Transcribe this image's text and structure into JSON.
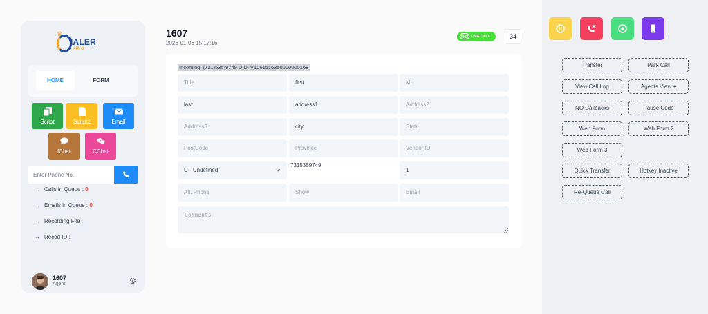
{
  "logo": {
    "text_main": "IALER",
    "text_sub": "KING"
  },
  "nav": {
    "home": "HOME",
    "form": "FORM"
  },
  "tools": [
    {
      "label": "Script",
      "color": "#2ea84a",
      "icon": "copy-icon"
    },
    {
      "label": "Script2",
      "color": "#fbbf24",
      "icon": "document-icon"
    },
    {
      "label": "Email",
      "color": "#1d8cf8",
      "icon": "envelope-icon"
    },
    {
      "label": "IChat",
      "color": "#b7773b",
      "icon": "chat-bubble-icon"
    },
    {
      "label": "CChat",
      "color": "#ec4899",
      "icon": "chat-bubbles-icon"
    }
  ],
  "phone": {
    "placeholder": "Enter Phone No.",
    "icon": "phone-icon"
  },
  "info": {
    "calls_label": "Calls in Queue : ",
    "calls_value": "0",
    "emails_label": "Emails in Queue : ",
    "emails_value": "0",
    "recording_label": "Recording File :",
    "record_label": "Recod ID :"
  },
  "agent": {
    "name": "1607",
    "role": "Agent"
  },
  "header": {
    "extension": "1607",
    "datetime": "2026-01-06 15:17:16",
    "live_short": "(((•)))",
    "live_label": "LIVE CALL",
    "counter": "34"
  },
  "incoming": "Incoming: (731)535-9749 UID: V1061516350000000168",
  "form": {
    "title": {
      "placeholder": "Title",
      "value": ""
    },
    "first": {
      "value": "first"
    },
    "mi": {
      "placeholder": "MI"
    },
    "last": {
      "value": "last"
    },
    "address1": {
      "value": "address1"
    },
    "address2": {
      "placeholder": "Address2"
    },
    "address3": {
      "placeholder": "Address3"
    },
    "city": {
      "value": "city"
    },
    "state": {
      "placeholder": "State"
    },
    "postcode": {
      "placeholder": "PostCode"
    },
    "province": {
      "placeholder": "Province"
    },
    "vendor_id": {
      "placeholder": "Vendor ID"
    },
    "gender": {
      "value": "U - Undefined"
    },
    "phone_number": {
      "value": "7315359749"
    },
    "phone_code": {
      "value": "1"
    },
    "alt_phone": {
      "placeholder": "Alt. Phone"
    },
    "show": {
      "placeholder": "Show"
    },
    "email": {
      "placeholder": "Email"
    },
    "comments": {
      "placeholder": "Comments"
    }
  },
  "quick_icons": [
    {
      "name": "pause-icon",
      "color": "#fcd34d"
    },
    {
      "name": "hangup-icon",
      "color": "#f43f5e"
    },
    {
      "name": "record-icon",
      "color": "#4ade80"
    },
    {
      "name": "mobile-icon",
      "color": "#7c3aed"
    }
  ],
  "actions": {
    "transfer": "Transfer",
    "park_call": "Park Call",
    "view_call_log": "View Call Log",
    "agents_view": "Agents View +",
    "no_callbacks": "NO Callbacks",
    "pause_code": "Pause Code",
    "web_form": "Web Form",
    "web_form_2": "Web Form 2",
    "web_form_3": "Web Form 3",
    "quick_transfer": "Quick Transfer",
    "hotkey_inactive": "Hotkey Inactive",
    "requeue_call": "Re-Queue Call"
  }
}
